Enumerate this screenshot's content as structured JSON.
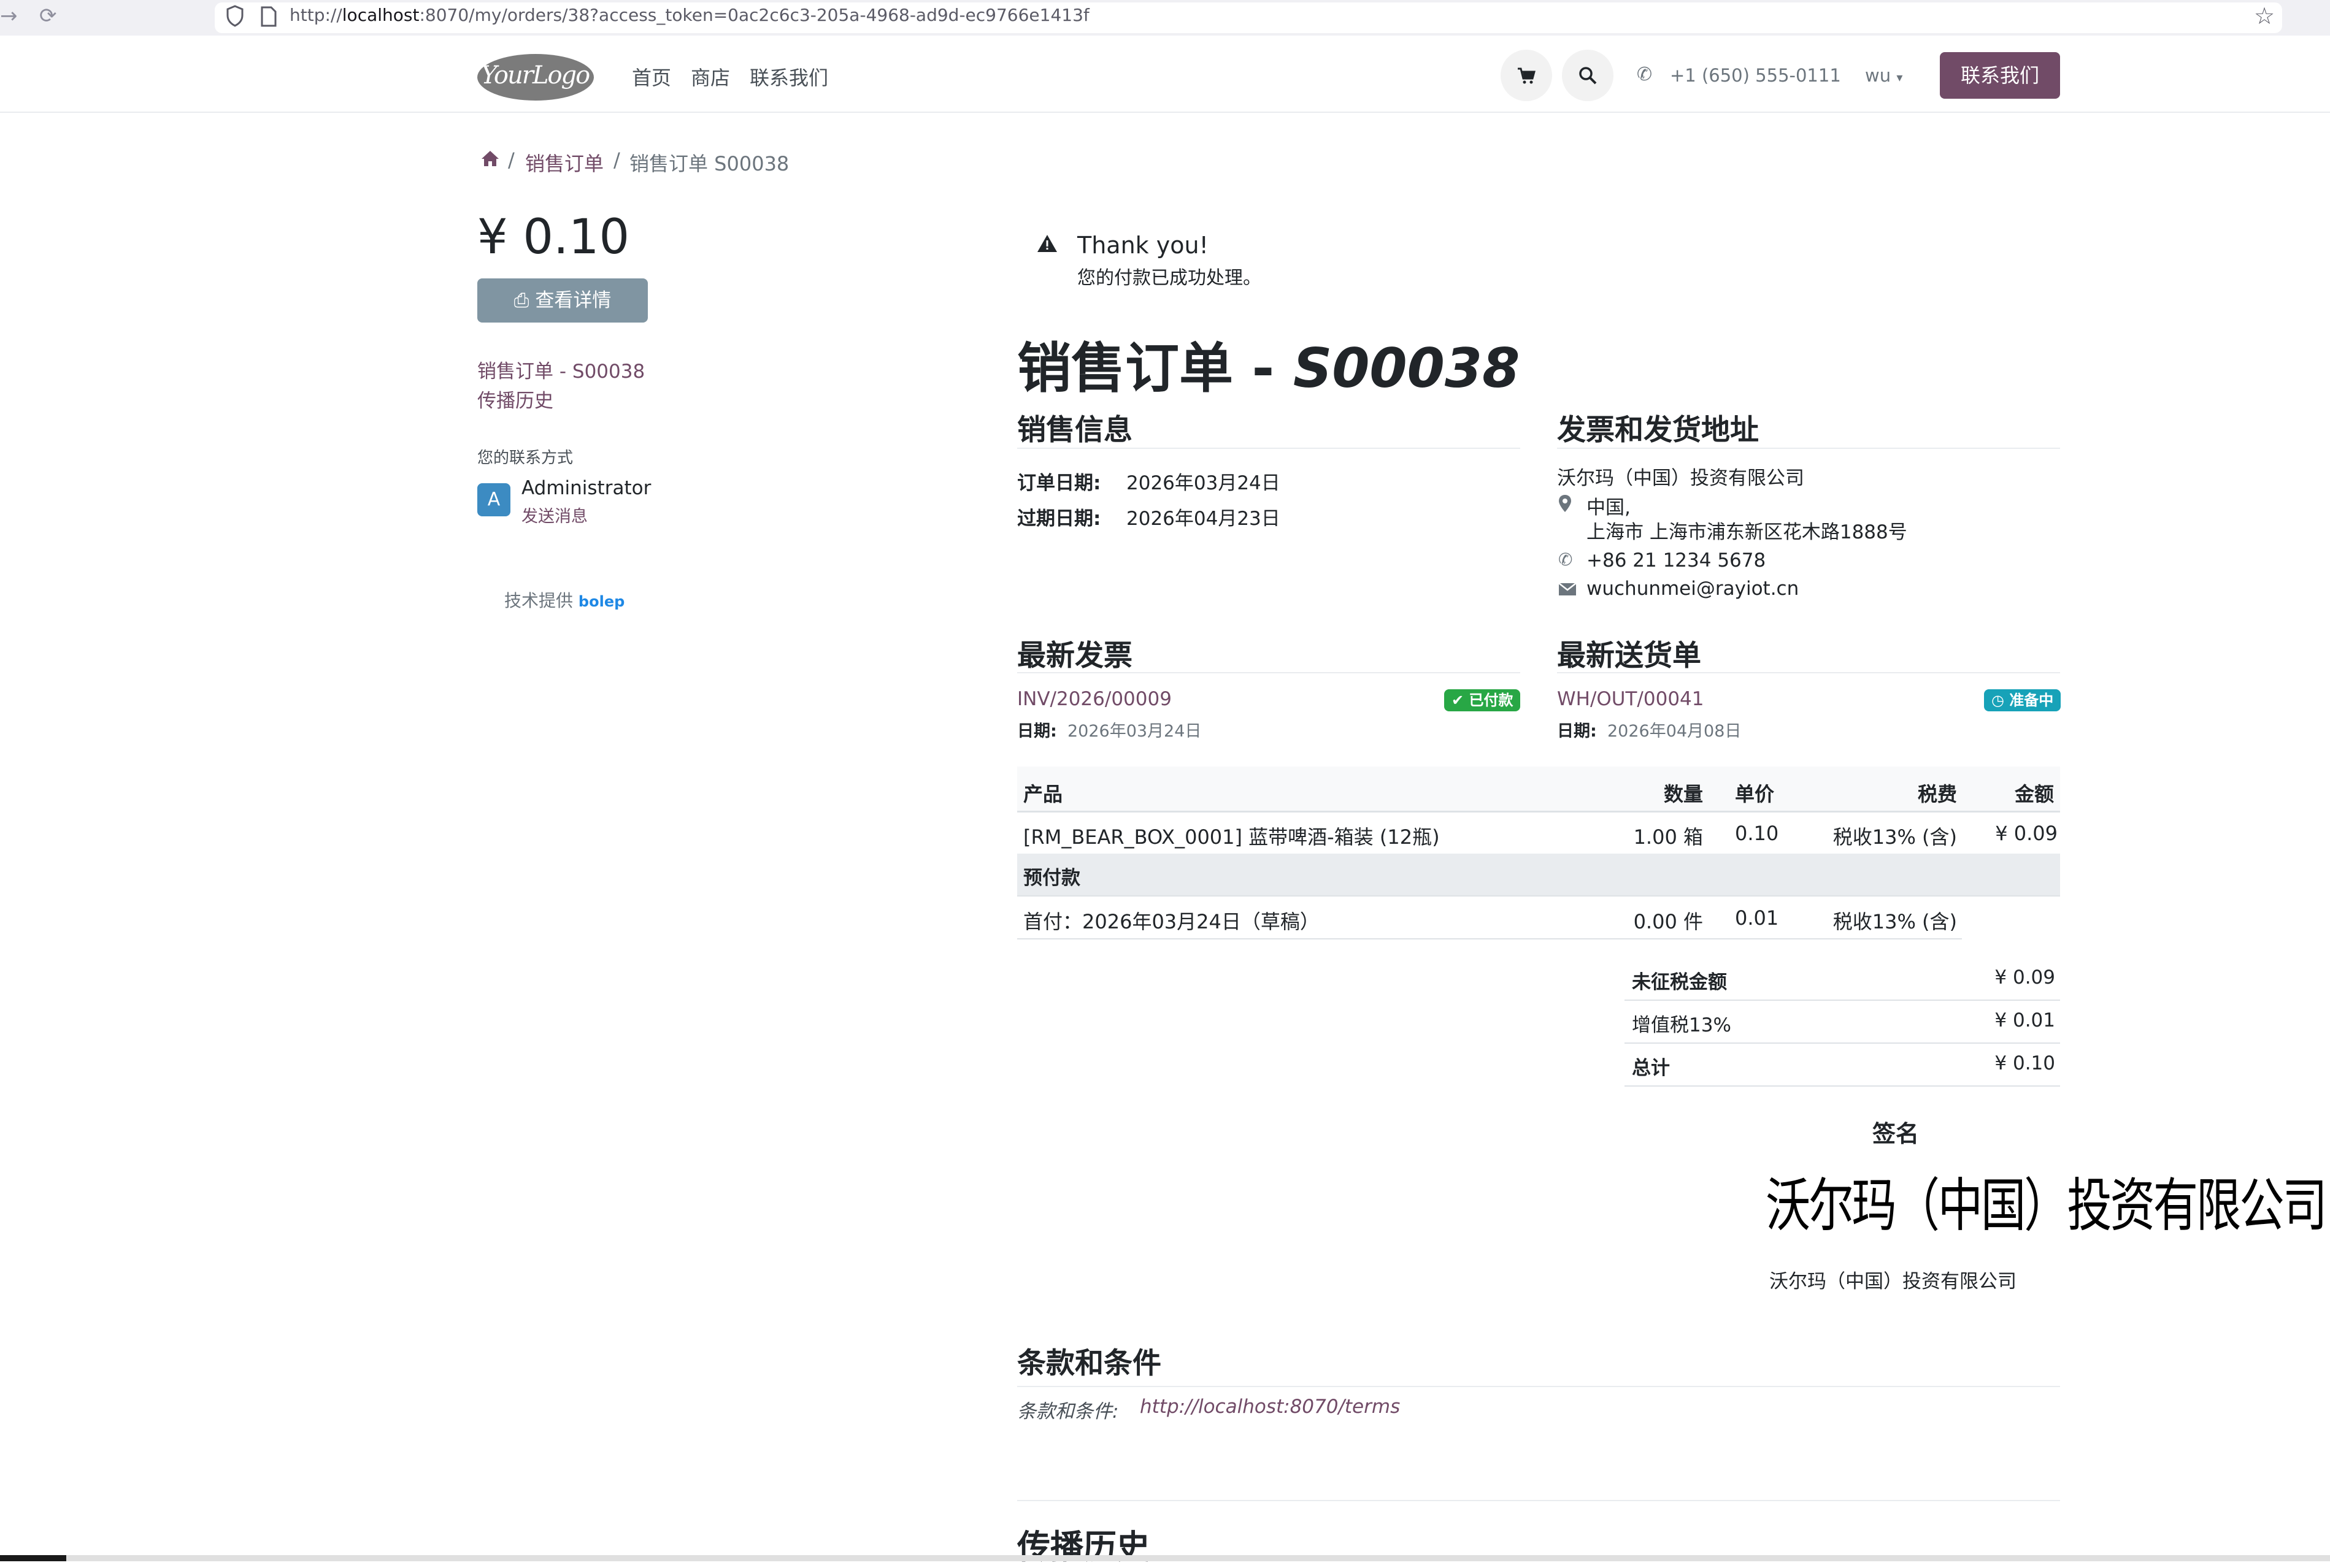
{
  "browser": {
    "url_prefix": "http://",
    "url_host": "localhost",
    "url_rest": ":8070/my/orders/38?access_token=0ac2c6c3-205a-4968-ad9d-ec9766e1413f"
  },
  "header": {
    "logo": "YourLogo",
    "nav": [
      "首页",
      "商店",
      "联系我们"
    ],
    "phone": "+1 (650) 555-0111",
    "user": "wu",
    "contact_button": "联系我们"
  },
  "breadcrumb": [
    "销售订单",
    "销售订单 S00038"
  ],
  "sidebar": {
    "amount": "¥ 0.10",
    "detail_button": "查看详情",
    "links": [
      "销售订单 - S00038",
      "传播历史"
    ],
    "contact_label": "您的联系方式",
    "avatar_letter": "A",
    "contact_name": "Administrator",
    "send_message": "发送消息",
    "powered_by": "技术提供",
    "powered_brand": "bolep"
  },
  "alert": {
    "title": "Thank you!",
    "message": "您的付款已成功处理。"
  },
  "order": {
    "title_prefix": "销售订单 - ",
    "number": "S00038",
    "sales_info": {
      "heading": "销售信息",
      "order_date_label": "订单日期:",
      "order_date": "2026年03月24日",
      "expiry_label": "过期日期:",
      "expiry_date": "2026年04月23日"
    },
    "address": {
      "heading": "发票和发货地址",
      "company": "沃尔玛（中国）投资有限公司",
      "country": "中国,",
      "street": "上海市 上海市浦东新区花木路1888号",
      "phone": "+86 21 1234 5678",
      "email": "wuchunmei@rayiot.cn"
    },
    "invoice": {
      "heading": "最新发票",
      "ref": "INV/2026/00009",
      "badge": "已付款",
      "date_label": "日期:",
      "date": "2026年03月24日"
    },
    "delivery": {
      "heading": "最新送货单",
      "ref": "WH/OUT/00041",
      "badge": "准备中",
      "date_label": "日期:",
      "date": "2026年04月08日"
    }
  },
  "table": {
    "headers": [
      "产品",
      "数量",
      "单价",
      "税费",
      "金额"
    ],
    "rows": [
      {
        "product": "[RM_BEAR_BOX_0001] 蓝带啤酒-箱装 (12瓶)",
        "qty": "1.00 箱",
        "price": "0.10",
        "tax": "税收13% (含)",
        "amount": "¥ 0.09"
      }
    ],
    "section": "预付款",
    "section_rows": [
      {
        "product": "首付：2026年03月24日（草稿）",
        "qty": "0.00 件",
        "price": "0.01",
        "tax": "税收13% (含)"
      }
    ]
  },
  "totals": [
    {
      "label": "未征税金额",
      "value": "¥ 0.09",
      "bold": true
    },
    {
      "label": "增值税13%",
      "value": "¥ 0.01",
      "bold": false
    },
    {
      "label": "总计",
      "value": "¥ 0.10",
      "bold": true
    }
  ],
  "signature": {
    "heading": "签名",
    "image_text": "沃尔玛（中国）投资有限公司",
    "name": "沃尔玛（中国）投资有限公司"
  },
  "terms": {
    "heading": "条款和条件",
    "label": "条款和条件:",
    "link": "http://localhost:8070/terms"
  },
  "history_heading": "传播历史",
  "colors": {
    "brand": "#714b67",
    "paid_badge": "#28a745",
    "ready_badge": "#17a2b8",
    "detail_button": "#8095a2"
  }
}
